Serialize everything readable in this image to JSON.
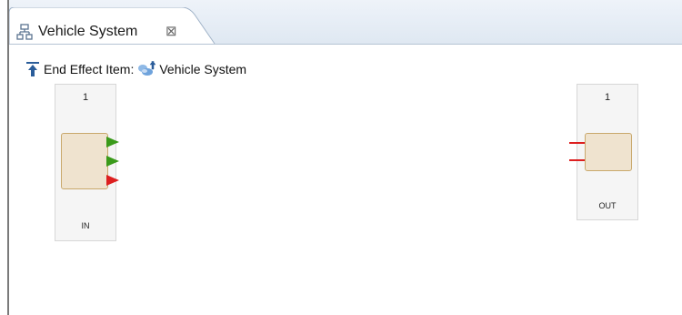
{
  "tab": {
    "title": "Vehicle System",
    "close_glyph": "⊠",
    "icon": "diagram-tree-icon"
  },
  "header": {
    "label": "End Effect Item:",
    "item_name": "Vehicle System",
    "pin_icon": "pin-icon",
    "item_icon": "system-item-icon"
  },
  "in_block": {
    "number": "1",
    "label": "IN",
    "output_arrows": [
      {
        "color": "#3a9a1a"
      },
      {
        "color": "#3a9a1a"
      },
      {
        "color": "#dd1f1f"
      }
    ]
  },
  "out_block": {
    "number": "1",
    "label": "OUT",
    "input_stubs": [
      {
        "color": "#dd1f1f"
      },
      {
        "color": "#dd1f1f"
      }
    ]
  },
  "colors": {
    "port_fill": "#efe3cf",
    "port_border": "#c9a86b",
    "tab_border": "#b5c3d3"
  }
}
